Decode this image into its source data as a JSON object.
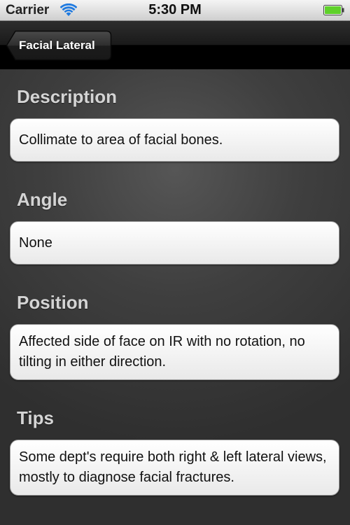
{
  "status_bar": {
    "carrier": "Carrier",
    "time": "5:30 PM",
    "battery_color": "#5fd12a"
  },
  "nav": {
    "back_label": "Facial Lateral"
  },
  "sections": [
    {
      "heading": "Description",
      "text": "Collimate to area of facial bones."
    },
    {
      "heading": "Angle",
      "text": "None"
    },
    {
      "heading": "Position",
      "text": "Affected side of face on IR with no rotation, no tilting in either direction."
    },
    {
      "heading": "Tips",
      "text": "Some dept's require both right & left lateral views, mostly to diagnose facial fractures."
    }
  ]
}
